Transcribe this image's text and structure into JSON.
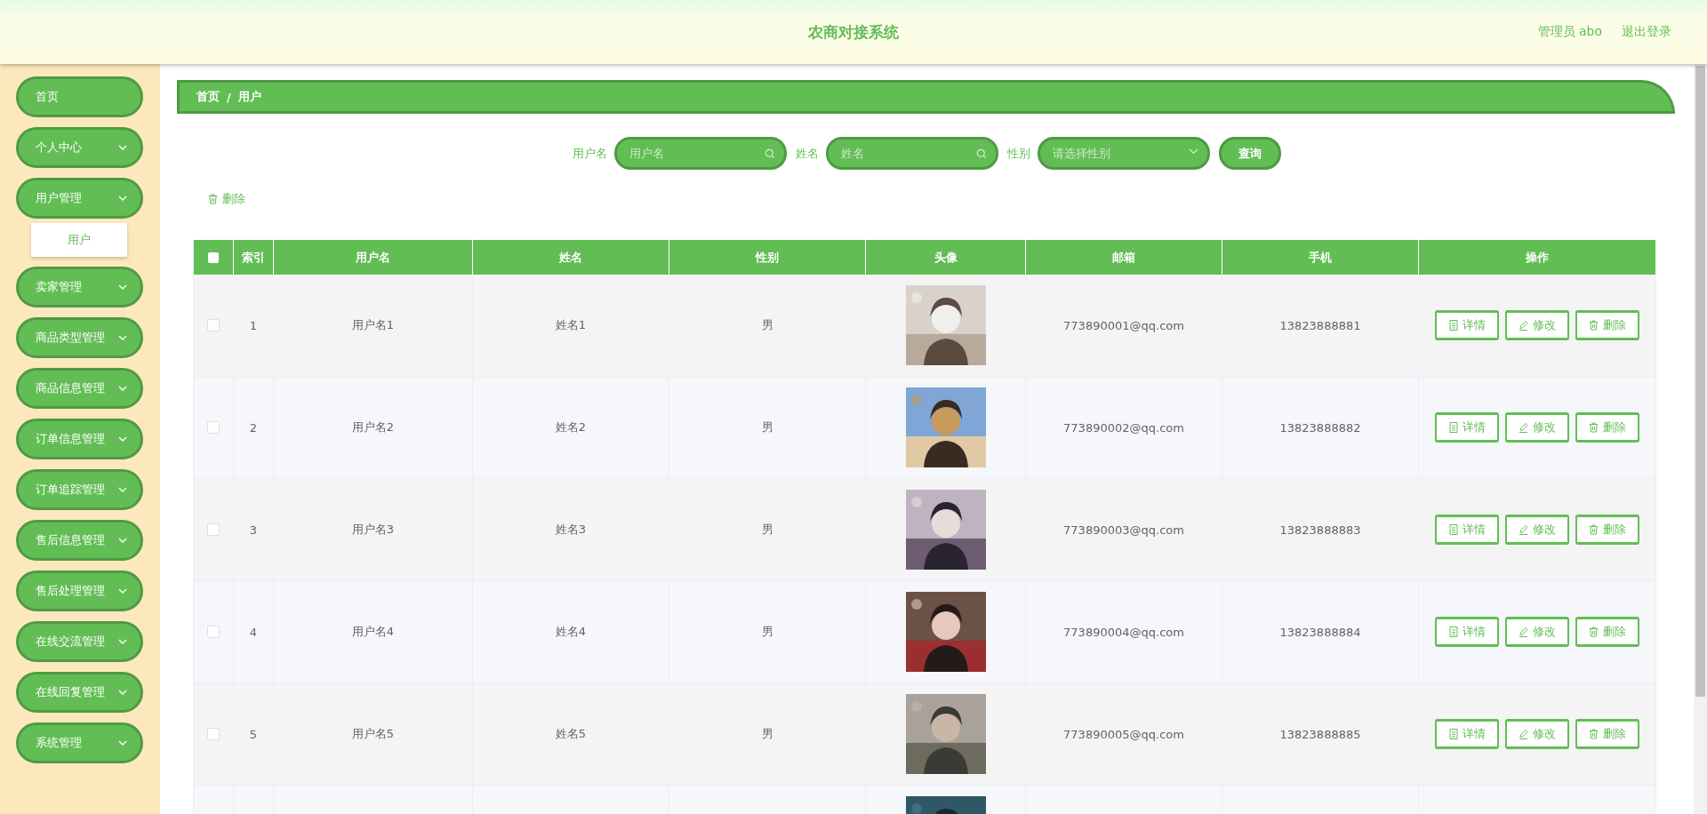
{
  "header": {
    "title": "农商对接系统",
    "user": "管理员 abo",
    "logout": "退出登录"
  },
  "sidebar": {
    "items": [
      {
        "label": "首页",
        "kind": "item"
      },
      {
        "label": "个人中心",
        "kind": "submenu"
      },
      {
        "label": "用户管理",
        "kind": "submenu",
        "children": [
          {
            "label": "用户"
          }
        ]
      },
      {
        "label": "卖家管理",
        "kind": "submenu"
      },
      {
        "label": "商品类型管理",
        "kind": "submenu"
      },
      {
        "label": "商品信息管理",
        "kind": "submenu"
      },
      {
        "label": "订单信息管理",
        "kind": "submenu"
      },
      {
        "label": "订单追踪管理",
        "kind": "submenu"
      },
      {
        "label": "售后信息管理",
        "kind": "submenu"
      },
      {
        "label": "售后处理管理",
        "kind": "submenu"
      },
      {
        "label": "在线交流管理",
        "kind": "submenu"
      },
      {
        "label": "在线回复管理",
        "kind": "submenu"
      },
      {
        "label": "系统管理",
        "kind": "submenu"
      }
    ]
  },
  "breadcrumb": [
    "首页",
    "/",
    "用户"
  ],
  "search": {
    "fields": [
      {
        "label": "用户名",
        "placeholder": "用户名",
        "kind": "text"
      },
      {
        "label": "姓名",
        "placeholder": "姓名",
        "kind": "text"
      },
      {
        "label": "性别",
        "placeholder": "请选择性别",
        "kind": "select"
      }
    ],
    "button": "查询"
  },
  "toolbar": {
    "delete": "删除"
  },
  "table": {
    "header_checked": false,
    "columns": [
      "索引",
      "用户名",
      "姓名",
      "性别",
      "头像",
      "邮箱",
      "手机",
      "操作"
    ],
    "rows": [
      {
        "checked": false,
        "index": "1",
        "username": "用户名1",
        "name": "姓名1",
        "gender": "男",
        "avatar": {
          "kind": "picture"
        },
        "email": "773890001@qq.com",
        "phone": "13823888881",
        "actions": [
          "详情",
          "修改",
          "删除"
        ]
      },
      {
        "checked": false,
        "index": "2",
        "username": "用户名2",
        "name": "姓名2",
        "gender": "男",
        "avatar": {
          "kind": "picture"
        },
        "email": "773890002@qq.com",
        "phone": "13823888882",
        "actions": [
          "详情",
          "修改",
          "删除"
        ]
      },
      {
        "checked": false,
        "index": "3",
        "username": "用户名3",
        "name": "姓名3",
        "gender": "男",
        "avatar": {
          "kind": "picture"
        },
        "email": "773890003@qq.com",
        "phone": "13823888883",
        "actions": [
          "详情",
          "修改",
          "删除"
        ]
      },
      {
        "checked": false,
        "index": "4",
        "username": "用户名4",
        "name": "姓名4",
        "gender": "男",
        "avatar": {
          "kind": "picture"
        },
        "email": "773890004@qq.com",
        "phone": "13823888884",
        "actions": [
          "详情",
          "修改",
          "删除"
        ]
      },
      {
        "checked": false,
        "index": "5",
        "username": "用户名5",
        "name": "姓名5",
        "gender": "男",
        "avatar": {
          "kind": "picture"
        },
        "email": "773890005@qq.com",
        "phone": "13823888885",
        "actions": [
          "详情",
          "修改",
          "删除"
        ]
      },
      {
        "avatar": {
          "kind": "picture"
        }
      }
    ]
  }
}
